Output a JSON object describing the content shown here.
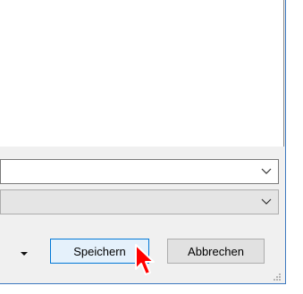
{
  "dialog": {
    "filename_combo": {
      "value": "",
      "icon": "chevron-down-icon"
    },
    "filetype_combo": {
      "value": "",
      "icon": "chevron-down-icon"
    },
    "menu_arrow_icon": "caret-down-icon",
    "buttons": {
      "save_label": "Speichern",
      "cancel_label": "Abbrechen"
    }
  },
  "colors": {
    "accent": "#0078d7",
    "cursor": "#ff0000"
  }
}
